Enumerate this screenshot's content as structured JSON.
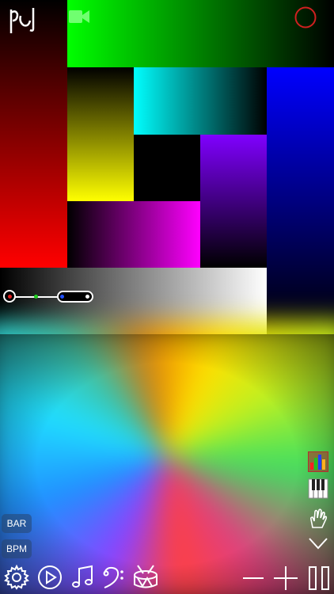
{
  "app": {
    "logo_name": "pd-logo"
  },
  "colors": {
    "record_ring": "#d02020",
    "camera": "#70ff70",
    "slider_left": "#e02020",
    "slider_mid": "#20d020",
    "slider_right": "#2050ff"
  },
  "left_controls": {
    "bar_label": "BAR",
    "bpm_label": "BPM"
  },
  "toolbar": {
    "icons": [
      "gear-icon",
      "play-icon",
      "music-note-icon",
      "bass-clef-icon",
      "drum-icon",
      "minus-icon",
      "plus-icon",
      "pause-icon"
    ]
  },
  "right_tools": {
    "icons": [
      "bars-icon",
      "piano-icon",
      "hand-icon",
      "chevron-down-icon"
    ]
  }
}
